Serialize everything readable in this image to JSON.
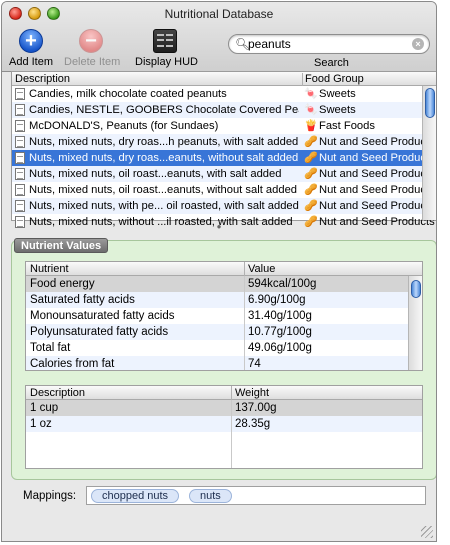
{
  "window": {
    "title": "Nutritional Database"
  },
  "toolbar": {
    "add_label": "Add Item",
    "delete_label": "Delete Item",
    "hud_label": "Display HUD",
    "search_label": "Search",
    "search_value": "peanuts"
  },
  "foods_table": {
    "columns": [
      "Description",
      "Food Group"
    ],
    "rows": [
      {
        "description": "Candies, milk chocolate coated peanuts",
        "group": "Sweets",
        "group_icon": "candy-icon"
      },
      {
        "description": "Candies, NESTLE, GOOBERS Chocolate Covered Peanuts",
        "group": "Sweets",
        "group_icon": "candy-icon"
      },
      {
        "description": "McDONALD'S, Peanuts (for Sundaes)",
        "group": "Fast Foods",
        "group_icon": "fries-icon"
      },
      {
        "description": "Nuts, mixed nuts, dry roas...h peanuts, with salt added",
        "group": "Nut and Seed Products",
        "group_icon": "nut-icon"
      },
      {
        "description": "Nuts, mixed nuts, dry roas...eanuts, without salt added",
        "group": "Nut and Seed Products",
        "group_icon": "nut-icon"
      },
      {
        "description": "Nuts, mixed nuts, oil roast...eanuts, with salt added",
        "group": "Nut and Seed Products",
        "group_icon": "nut-icon"
      },
      {
        "description": "Nuts, mixed nuts, oil roast...eanuts, without salt added",
        "group": "Nut and Seed Products",
        "group_icon": "nut-icon"
      },
      {
        "description": "Nuts, mixed nuts, with pe... oil roasted, with salt added",
        "group": "Nut and Seed Products",
        "group_icon": "nut-icon"
      },
      {
        "description": "Nuts, mixed nuts, without ...il roasted, with salt added",
        "group": "Nut and Seed Products",
        "group_icon": "nut-icon"
      }
    ],
    "selected_index": 4
  },
  "nutrient_panel": {
    "title": "Nutrient Values",
    "columns": [
      "Nutrient",
      "Value"
    ],
    "rows": [
      {
        "name": "Food energy",
        "value": "594kcal/100g"
      },
      {
        "name": "Saturated fatty acids",
        "value": "6.90g/100g"
      },
      {
        "name": "Monounsaturated fatty acids",
        "value": "31.40g/100g"
      },
      {
        "name": "Polyunsaturated fatty acids",
        "value": "10.77g/100g"
      },
      {
        "name": "Total fat",
        "value": "49.06g/100g"
      },
      {
        "name": "Calories from fat",
        "value": "74"
      }
    ],
    "weights_columns": [
      "Description",
      "Weight"
    ],
    "weights": [
      {
        "desc": "1 cup",
        "weight": "137.00g"
      },
      {
        "desc": "1 oz",
        "weight": "28.35g"
      }
    ]
  },
  "mappings": {
    "label": "Mappings:",
    "tokens": [
      "chopped nuts",
      "nuts"
    ]
  },
  "colors": {
    "selection": "#3875d7",
    "panel_bg": "#dff2d8",
    "stripe": "#edf3fe"
  }
}
